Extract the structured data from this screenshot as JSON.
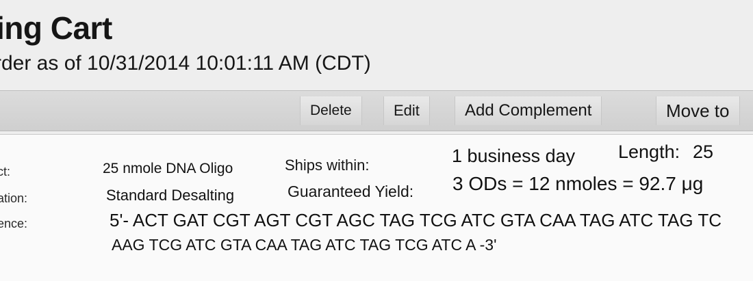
{
  "header": {
    "title": "ing Cart",
    "order_line": "rder as of 10/31/2014 10:01:11 AM (CDT)"
  },
  "toolbar": {
    "delete_label": "Delete",
    "edit_label": "Edit",
    "add_complement_label": "Add Complement",
    "move_to_label": "Move to"
  },
  "item": {
    "product_label": "ct:",
    "product_value": "25 nmole DNA Oligo",
    "purification_label": "ation:",
    "purification_value": "Standard Desalting",
    "sequence_label": "ence:",
    "ships_label": "Ships within:",
    "ships_value": "1 business day",
    "length_label": "Length:",
    "length_value": "25",
    "yield_label": "Guaranteed Yield:",
    "yield_value": "3 ODs = 12 nmoles = 92.7 μg",
    "sequence_line1": "5'- ACT GAT CGT AGT CGT AGC TAG TCG ATC GTA CAA TAG ATC TAG TC",
    "sequence_line2": "AAG TCG ATC GTA CAA TAG ATC TAG TCG ATC A -3'"
  }
}
